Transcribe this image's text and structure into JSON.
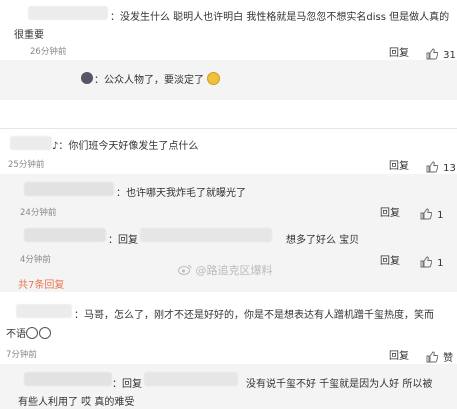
{
  "comments": [
    {
      "text_line1": "：没发生什么  聪明人也许明白 我性格就是马忽忽不想实名diss 但是做人真的",
      "text_line2": "很重要",
      "time": "26分钟前",
      "reply_label": "回复",
      "like_count": "31"
    },
    {
      "reply_text": "：公众人物了，要淡定了",
      "emoji": "face-icon"
    },
    {
      "text": "：你们班今天好像发生了点什么",
      "time": "25分钟前",
      "reply_label": "回复",
      "like_count": "13"
    },
    {
      "text": "：也许哪天我炸毛了就曝光了",
      "time": "24分钟前",
      "reply_label": "回复",
      "like_count": "1"
    },
    {
      "prefix": "：回复",
      "text": "想多了好么  宝贝",
      "time": "4分钟前",
      "reply_label": "回复",
      "like_count": "1"
    },
    {
      "more_replies": "共7条回复"
    },
    {
      "text_line1": "：马哥，怎么了，刚才不还是好好的，你是不是想表达有人蹭机蹭千玺热度，笑而",
      "text_line2": "不语",
      "time": "7分钟前",
      "reply_label": "回复",
      "like_label": "赞"
    },
    {
      "prefix": "：回复",
      "text_line1": "没有说千玺不好  千玺就是因为人好 所以被",
      "text_line2": "有些人利用了 哎 真的难受"
    }
  ],
  "watermark": "@路追克区爆料"
}
